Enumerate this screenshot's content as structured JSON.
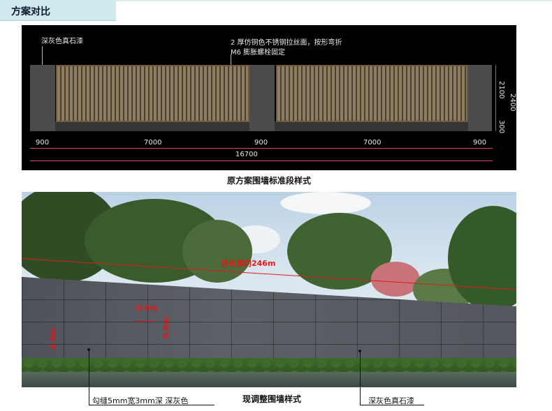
{
  "header": {
    "title": "方案对比"
  },
  "elevation": {
    "label_stone": "深灰色真石漆",
    "label_steel_line1": "2 厚仿铜色不锈钢拉丝面，按形弯折",
    "label_steel_line2": "M6 膨胀螺栓固定",
    "dims": {
      "pillar_left": "900",
      "panel_left": "7000",
      "pillar_mid": "900",
      "panel_right": "7000",
      "pillar_right": "900",
      "total": "16700",
      "h_2100": "2100",
      "h_300": "300",
      "h_2400": "2400"
    },
    "caption": "原方案围墙标准段样式"
  },
  "photo": {
    "total_length": "总长度约246m",
    "width_06": "0.6m",
    "height_08": "0.8m",
    "height_24": "2.4m",
    "callout_joint": "勾缝5mm宽3mm深   深灰色",
    "callout_stone": "深灰色真石漆",
    "caption": "现调整围墙样式"
  },
  "colors": {
    "accent_tab": "#cfe9ec",
    "annotation_red": "#e01a1a"
  }
}
